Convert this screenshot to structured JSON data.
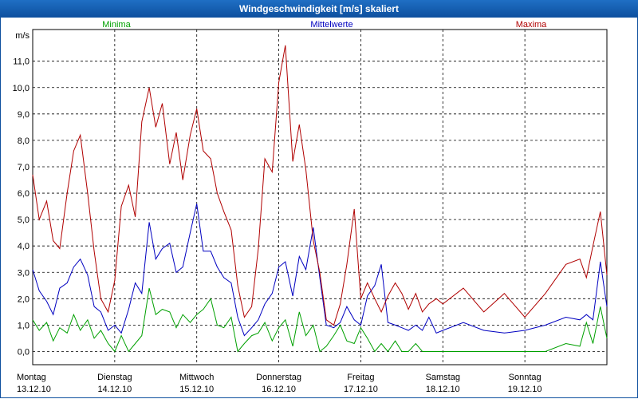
{
  "window": {
    "title": "Windgeschwindigkeit [m/s] skaliert"
  },
  "chart_data": {
    "type": "line",
    "title": "Windgeschwindigkeit [m/s] skaliert",
    "ylabel": "m/s",
    "ylim": [
      -0.5,
      12.2
    ],
    "xlim": [
      0,
      7
    ],
    "y_ticks": [
      "0,0",
      "1,0",
      "2,0",
      "3,0",
      "4,0",
      "5,0",
      "6,0",
      "7,0",
      "8,0",
      "9,0",
      "10,0",
      "11,0"
    ],
    "x_ticks": [
      {
        "day": "Montag",
        "date": "13.12.10"
      },
      {
        "day": "Dienstag",
        "date": "14.12.10"
      },
      {
        "day": "Mittwoch",
        "date": "15.12.10"
      },
      {
        "day": "Donnerstag",
        "date": "16.12.10"
      },
      {
        "day": "Freitag",
        "date": "17.12.10"
      },
      {
        "day": "Samstag",
        "date": "18.12.10"
      },
      {
        "day": "Sonntag",
        "date": "19.12.10"
      }
    ],
    "grid": true,
    "legend_placement": "top",
    "series": [
      {
        "name": "Minima",
        "color": "#00a000",
        "x": [
          0.0,
          0.08,
          0.17,
          0.25,
          0.33,
          0.42,
          0.5,
          0.58,
          0.67,
          0.75,
          0.83,
          0.92,
          1.0,
          1.08,
          1.17,
          1.25,
          1.33,
          1.42,
          1.5,
          1.58,
          1.67,
          1.75,
          1.83,
          1.92,
          2.0,
          2.08,
          2.17,
          2.25,
          2.33,
          2.42,
          2.5,
          2.58,
          2.67,
          2.75,
          2.83,
          2.92,
          3.0,
          3.08,
          3.17,
          3.25,
          3.33,
          3.42,
          3.5,
          3.58,
          3.67,
          3.75,
          3.83,
          3.92,
          4.0,
          4.08,
          4.17,
          4.25,
          4.33,
          4.42,
          4.5,
          4.58,
          4.67,
          4.75,
          4.83,
          4.92,
          5.0,
          5.25,
          5.5,
          5.75,
          6.0,
          6.25,
          6.5,
          6.67,
          6.75,
          6.83,
          6.92,
          7.0
        ],
        "y": [
          1.2,
          0.8,
          1.1,
          0.4,
          0.9,
          0.7,
          1.4,
          0.8,
          1.2,
          0.5,
          0.8,
          0.3,
          0.0,
          0.6,
          0.0,
          0.3,
          0.6,
          2.4,
          1.4,
          1.6,
          1.5,
          0.9,
          1.4,
          1.1,
          1.4,
          1.6,
          2.0,
          1.0,
          0.9,
          1.3,
          0.0,
          0.3,
          0.6,
          0.7,
          1.1,
          0.4,
          0.9,
          1.2,
          0.2,
          1.5,
          0.6,
          1.0,
          0.0,
          0.2,
          0.6,
          1.0,
          0.4,
          0.3,
          0.9,
          0.5,
          0.0,
          0.3,
          0.0,
          0.4,
          0.0,
          0.0,
          0.3,
          0.0,
          0.0,
          0.0,
          0.0,
          0.0,
          0.0,
          0.0,
          0.0,
          0.0,
          0.3,
          0.2,
          1.1,
          0.3,
          1.7,
          0.5
        ]
      },
      {
        "name": "Mittelwerte",
        "color": "#0000c0",
        "x": [
          0.0,
          0.08,
          0.17,
          0.25,
          0.33,
          0.42,
          0.5,
          0.58,
          0.67,
          0.75,
          0.83,
          0.92,
          1.0,
          1.08,
          1.17,
          1.25,
          1.33,
          1.42,
          1.5,
          1.58,
          1.67,
          1.75,
          1.83,
          1.92,
          2.0,
          2.08,
          2.17,
          2.25,
          2.33,
          2.42,
          2.5,
          2.58,
          2.67,
          2.75,
          2.83,
          2.92,
          3.0,
          3.08,
          3.17,
          3.25,
          3.33,
          3.42,
          3.5,
          3.58,
          3.67,
          3.75,
          3.83,
          3.92,
          4.0,
          4.08,
          4.17,
          4.25,
          4.33,
          4.42,
          4.5,
          4.58,
          4.67,
          4.75,
          4.83,
          4.92,
          5.0,
          5.25,
          5.5,
          5.75,
          6.0,
          6.25,
          6.5,
          6.67,
          6.75,
          6.83,
          6.92,
          7.0
        ],
        "y": [
          3.1,
          2.3,
          1.9,
          1.4,
          2.4,
          2.6,
          3.2,
          3.5,
          2.9,
          1.7,
          1.5,
          0.8,
          1.0,
          0.7,
          1.6,
          2.6,
          2.2,
          4.9,
          3.5,
          3.9,
          4.1,
          3.0,
          3.2,
          4.5,
          5.6,
          3.8,
          3.8,
          3.2,
          2.8,
          2.6,
          1.3,
          0.6,
          0.9,
          1.2,
          1.8,
          2.2,
          3.2,
          3.4,
          2.1,
          3.6,
          3.1,
          4.7,
          2.8,
          1.0,
          0.9,
          1.1,
          1.7,
          1.2,
          1.0,
          2.1,
          2.5,
          3.3,
          1.1,
          1.0,
          0.9,
          0.8,
          1.0,
          0.8,
          1.3,
          0.7,
          0.8,
          1.1,
          0.8,
          0.7,
          0.8,
          1.0,
          1.3,
          1.2,
          1.4,
          1.2,
          3.4,
          1.7
        ]
      },
      {
        "name": "Maxima",
        "color": "#b00000",
        "x": [
          0.0,
          0.08,
          0.17,
          0.25,
          0.33,
          0.42,
          0.5,
          0.58,
          0.67,
          0.75,
          0.83,
          0.92,
          1.0,
          1.08,
          1.17,
          1.25,
          1.33,
          1.42,
          1.5,
          1.58,
          1.67,
          1.75,
          1.83,
          1.92,
          2.0,
          2.08,
          2.17,
          2.25,
          2.33,
          2.42,
          2.5,
          2.58,
          2.67,
          2.75,
          2.83,
          2.92,
          3.0,
          3.08,
          3.17,
          3.25,
          3.33,
          3.42,
          3.5,
          3.58,
          3.67,
          3.75,
          3.83,
          3.92,
          4.0,
          4.08,
          4.17,
          4.25,
          4.33,
          4.42,
          4.5,
          4.58,
          4.67,
          4.75,
          4.83,
          4.92,
          5.0,
          5.25,
          5.5,
          5.75,
          6.0,
          6.25,
          6.5,
          6.67,
          6.75,
          6.83,
          6.92,
          7.0
        ],
        "y": [
          6.7,
          5.0,
          5.7,
          4.2,
          3.9,
          6.0,
          7.6,
          8.2,
          6.0,
          3.8,
          2.0,
          1.5,
          2.7,
          5.5,
          6.3,
          5.1,
          8.7,
          10.0,
          8.5,
          9.4,
          7.1,
          8.3,
          6.5,
          8.2,
          9.2,
          7.6,
          7.3,
          6.0,
          5.3,
          4.6,
          2.5,
          1.3,
          1.7,
          3.9,
          7.3,
          6.8,
          10.2,
          11.6,
          7.2,
          8.6,
          6.9,
          4.2,
          3.0,
          1.2,
          1.0,
          1.8,
          3.3,
          5.4,
          2.0,
          2.6,
          2.0,
          1.5,
          2.1,
          2.6,
          2.2,
          1.6,
          2.2,
          1.5,
          1.8,
          2.0,
          1.8,
          2.4,
          1.5,
          2.2,
          1.3,
          2.2,
          3.3,
          3.5,
          2.8,
          4.0,
          5.3,
          2.9
        ]
      }
    ]
  }
}
